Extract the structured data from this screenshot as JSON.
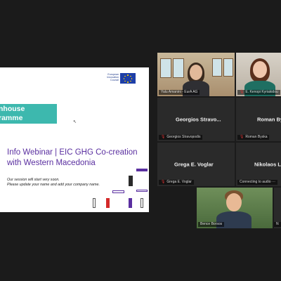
{
  "slide": {
    "eic_line1": "European",
    "eic_line2": "Innovation",
    "eic_line3": "Council",
    "banner_line1": "nhouse",
    "banner_line2": "ramme",
    "title_line1": "Info Webinar | EIC GHG Co-creation",
    "title_line2": "with Western Macedonia",
    "subtitle_line1": "Our session will start very soon.",
    "subtitle_line2": "Please update your name and add your company name.",
    "accent_color": "#5a2fa0",
    "banner_color": "#3db8ae"
  },
  "participants": [
    {
      "label": "Yalu Amanini - EurA AG",
      "display": "",
      "video": true,
      "active": true
    },
    {
      "label": "E. Kenopi Kyriakidou",
      "display": "",
      "video": true,
      "active": false
    },
    {
      "label": "Georgios Stravopodis",
      "display": "Georgios  Stravo...",
      "video": false
    },
    {
      "label": "Roman Byska",
      "display": "Roman Bys",
      "video": false
    },
    {
      "label": "Grega E. Voglar",
      "display": "Grega E. Voglar",
      "video": false
    },
    {
      "label": "Connecting to audio ···",
      "display": "Nikolaos Liv",
      "video": false
    },
    {
      "label": "Bence Borsos",
      "display": "",
      "video": true,
      "active": false
    },
    {
      "label": "N",
      "display": "",
      "video": false
    }
  ],
  "icons": {
    "mic": "mic-muted-icon"
  }
}
